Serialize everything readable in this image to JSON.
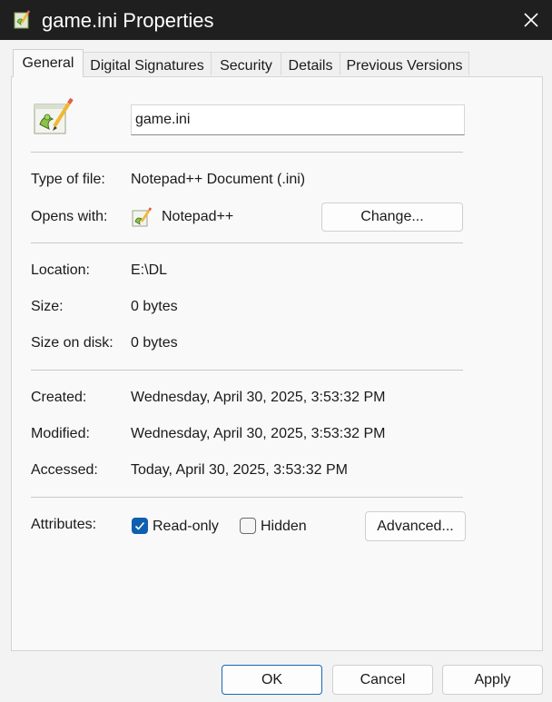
{
  "window": {
    "title": "game.ini Properties",
    "title_icon": "notepad-plus-plus-icon",
    "close_icon": "close-icon"
  },
  "tabs": [
    {
      "label": "General",
      "active": true
    },
    {
      "label": "Digital Signatures",
      "active": false
    },
    {
      "label": "Security",
      "active": false
    },
    {
      "label": "Details",
      "active": false
    },
    {
      "label": "Previous Versions",
      "active": false
    }
  ],
  "general": {
    "file_icon": "notepad-plus-plus-file-icon",
    "file_name": "game.ini",
    "type_of_file": {
      "label": "Type of file:",
      "value": "Notepad++ Document (.ini)"
    },
    "opens_with": {
      "label": "Opens with:",
      "value": "Notepad++",
      "icon": "notepad-plus-plus-icon",
      "change_label": "Change..."
    },
    "location": {
      "label": "Location:",
      "value": "E:\\DL"
    },
    "size": {
      "label": "Size:",
      "value": "0 bytes"
    },
    "size_on_disk": {
      "label": "Size on disk:",
      "value": "0 bytes"
    },
    "created": {
      "label": "Created:",
      "value": "Wednesday, April 30, 2025, 3:53:32 PM"
    },
    "modified": {
      "label": "Modified:",
      "value": "Wednesday, April 30, 2025, 3:53:32 PM"
    },
    "accessed": {
      "label": "Accessed:",
      "value": "Today, April 30, 2025, 3:53:32 PM"
    },
    "attributes": {
      "label": "Attributes:",
      "read_only": {
        "label": "Read-only",
        "checked": true
      },
      "hidden": {
        "label": "Hidden",
        "checked": false
      },
      "advanced_label": "Advanced..."
    }
  },
  "footer": {
    "ok_label": "OK",
    "cancel_label": "Cancel",
    "apply_label": "Apply"
  },
  "colors": {
    "titlebar": "#1f1f1f",
    "accent": "#0f5fb0",
    "panel": "#f9f9f9"
  }
}
